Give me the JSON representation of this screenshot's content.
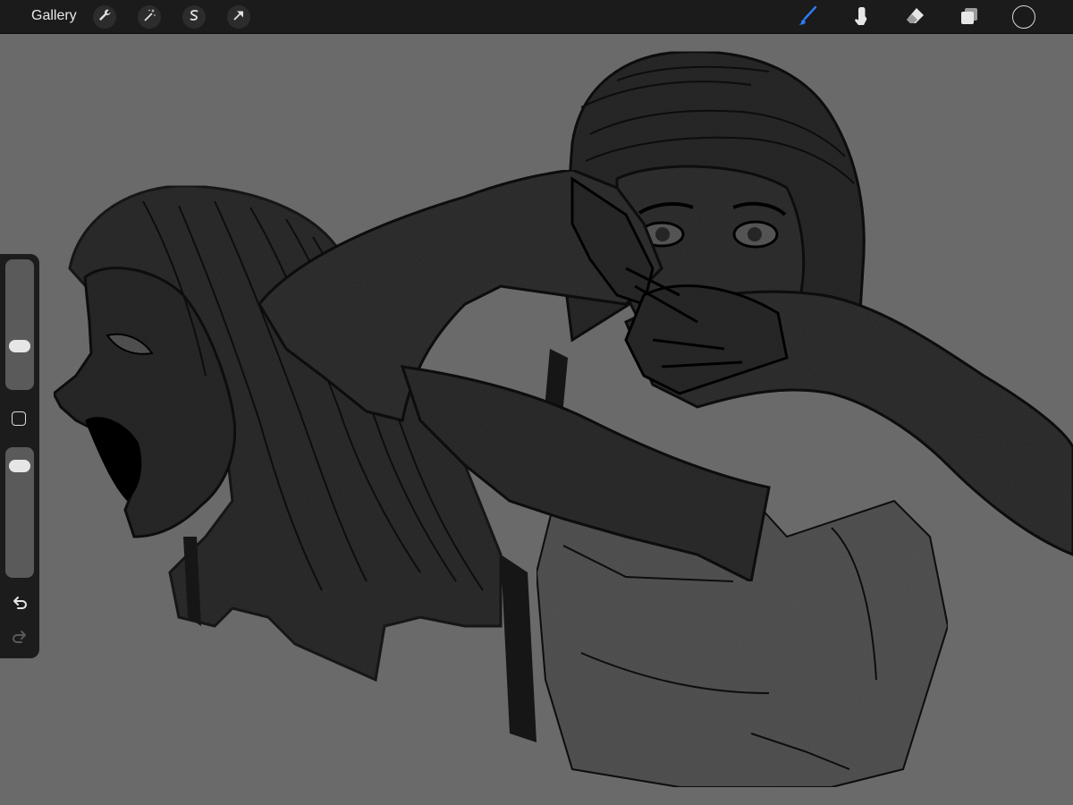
{
  "topbar": {
    "gallery_label": "Gallery",
    "left_tools": [
      {
        "name": "actions",
        "icon": "wrench-icon"
      },
      {
        "name": "adjustments",
        "icon": "magic-wand-icon"
      },
      {
        "name": "selection",
        "icon": "selection-s-icon"
      },
      {
        "name": "transform",
        "icon": "arrow-cursor-icon"
      }
    ],
    "right_tools": [
      {
        "name": "brush",
        "icon": "brush-icon",
        "active": true
      },
      {
        "name": "smudge",
        "icon": "smudge-finger-icon",
        "active": false
      },
      {
        "name": "eraser",
        "icon": "eraser-icon",
        "active": false
      },
      {
        "name": "layers",
        "icon": "layers-icon",
        "active": false
      }
    ],
    "current_color": "#1a1a1a"
  },
  "sidebar": {
    "brush_size_level": 0.31,
    "opacity_level": 0.92,
    "modify_icon": "square-modify-icon",
    "undo_icon": "undo-arrow-icon",
    "redo_icon": "redo-arrow-icon"
  },
  "colors": {
    "toolbar_bg": "#1b1b1b",
    "canvas_bg": "#6a6a6a",
    "accent_active": "#2f7bf5",
    "ink": "#1a1a1a",
    "skin_dark": "#333333"
  }
}
